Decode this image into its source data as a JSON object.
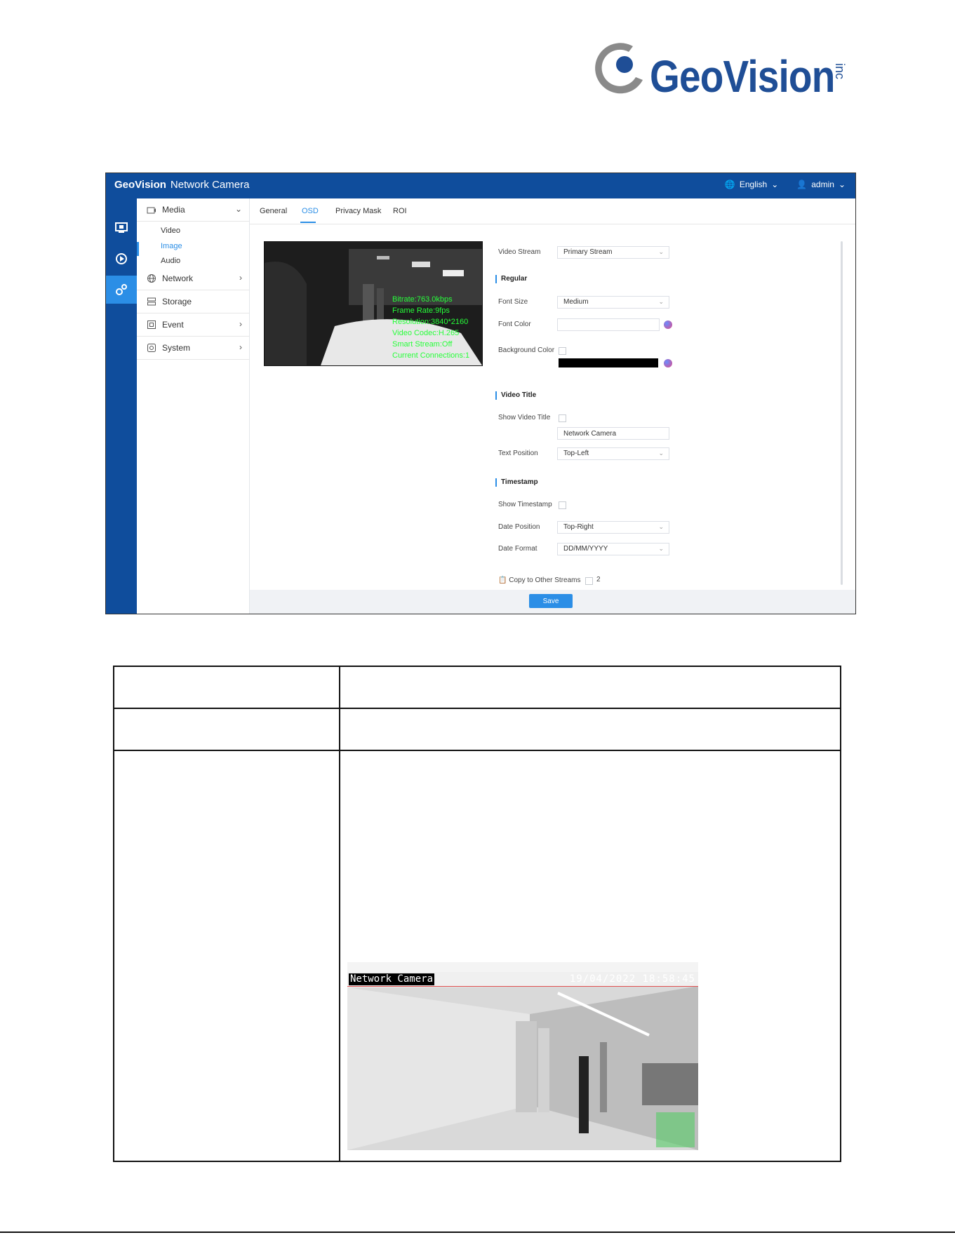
{
  "logo": {
    "name": "GeoVision",
    "suffix": "inc"
  },
  "screenshot": {
    "brand": "GeoVision",
    "app_title": "Network Camera",
    "language": "English",
    "user": "admin",
    "nav": {
      "media": "Media",
      "media_items": [
        "Video",
        "Image",
        "Audio"
      ],
      "network": "Network",
      "storage": "Storage",
      "event": "Event",
      "system": "System"
    },
    "tabs": [
      "General",
      "OSD",
      "Privacy Mask",
      "ROI"
    ],
    "preview_osd": [
      "Bitrate:763.0kbps",
      "Frame Rate:9fps",
      "Resolution:3840*2160",
      "Video Codec:H.265",
      "Smart Stream:Off",
      "Current Connections:1"
    ],
    "form": {
      "video_stream_label": "Video Stream",
      "video_stream_value": "Primary Stream",
      "regular_title": "Regular",
      "font_size_label": "Font Size",
      "font_size_value": "Medium",
      "font_color_label": "Font Color",
      "background_color_label": "Background Color",
      "video_title_title": "Video Title",
      "show_video_title_label": "Show Video Title",
      "video_title_value": "Network Camera",
      "text_position_label": "Text Position",
      "text_position_value": "Top-Left",
      "timestamp_title": "Timestamp",
      "show_timestamp_label": "Show Timestamp",
      "date_position_label": "Date Position",
      "date_position_value": "Top-Right",
      "date_format_label": "Date Format",
      "date_format_value": "DD/MM/YYYY",
      "copy_label": "Copy to Other Streams",
      "copy_count": "2",
      "save_label": "Save"
    },
    "colors": {
      "header": "#0f4d9c",
      "accent": "#2b8ee6",
      "osd_text": "#27ff3a"
    }
  },
  "example_image": {
    "title_osd": "Network Camera",
    "timestamp_osd": "19/04/2022  18:58:45"
  }
}
